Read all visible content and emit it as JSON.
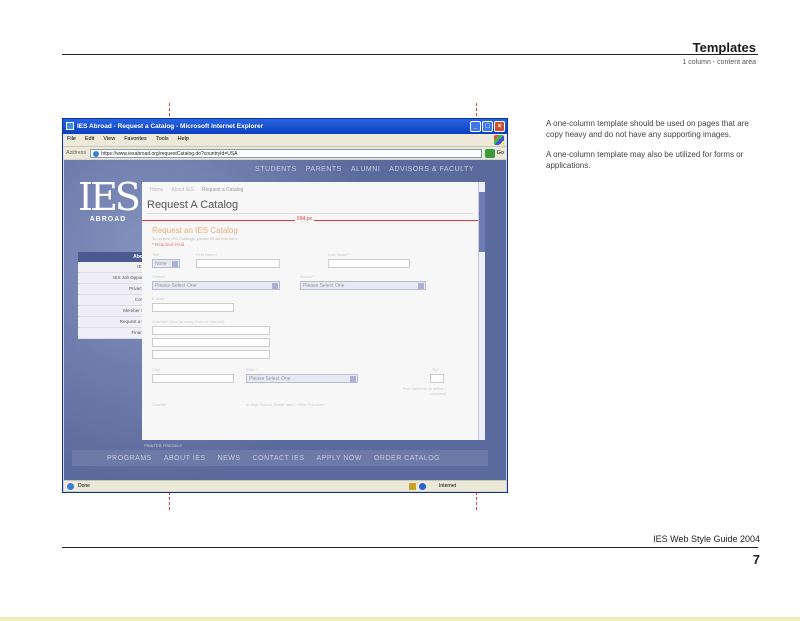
{
  "header": {
    "title": "Templates",
    "subtitle": "1 column - content area"
  },
  "description": [
    "A one-column template should be used on pages that are copy heavy and do not have any supporting images.",
    "A one-column template may also be utilized for forms or applications."
  ],
  "footer": {
    "guide_title": "IES Web Style Guide 2004",
    "page_number": "7"
  },
  "browser": {
    "window_title": "IES Abroad - Request a Catalog - Microsoft Internet Explorer",
    "menu": [
      "File",
      "Edit",
      "View",
      "Favorites",
      "Tools",
      "Help"
    ],
    "address_label": "Address",
    "address_url": "https://www.iesabroad.org/requestCatalog.do?countryId=USA",
    "go_label": "Go",
    "status_left": "Done",
    "status_zone": "Internet"
  },
  "site": {
    "logo_big": "IES",
    "logo_small": "ABROAD",
    "top_nav": [
      "STUDENTS",
      "PARENTS",
      "ALUMNI",
      "ADVISORS & FACULTY"
    ],
    "breadcrumb": [
      "Home",
      "About IES",
      "Request a Catalog"
    ],
    "page_heading": "Request A Catalog",
    "measure_label": "594 px",
    "form_title": "Request an IES Catalog",
    "form_subtitle": "To receive IES Catalogs, please fill out this form.",
    "required_note": "* Required Field",
    "labels": {
      "title": "Title",
      "first_name": "First Name*",
      "last_name": "Last Name*",
      "status": "Status*",
      "school": "School*",
      "email": "E-mail*",
      "address": "Address* (Use as many lines as needed)",
      "city": "City*",
      "state": "State*",
      "zip": "Zip*",
      "country": "Country*",
      "hs_grad": "In High School Grade* and Y Prior Function*",
      "zip_note": "Five numbers or letters / numbers"
    },
    "selects": {
      "title": "None",
      "status": "Please Select One",
      "school": "Please Select One",
      "state": "Please Select One"
    },
    "sidebar_head": "About IES",
    "sidebar_items": [
      "IES News",
      "IES Job Opportunities",
      "Privacy Policy",
      "Contact Us",
      "Member Schools",
      "Request a Catalog",
      "Financial Aid"
    ],
    "printer_friendly": "PRINTER FRIENDLY",
    "footer_nav": [
      "PROGRAMS",
      "ABOUT IES",
      "NEWS",
      "CONTACT IES",
      "APPLY NOW",
      "ORDER CATALOG"
    ]
  }
}
